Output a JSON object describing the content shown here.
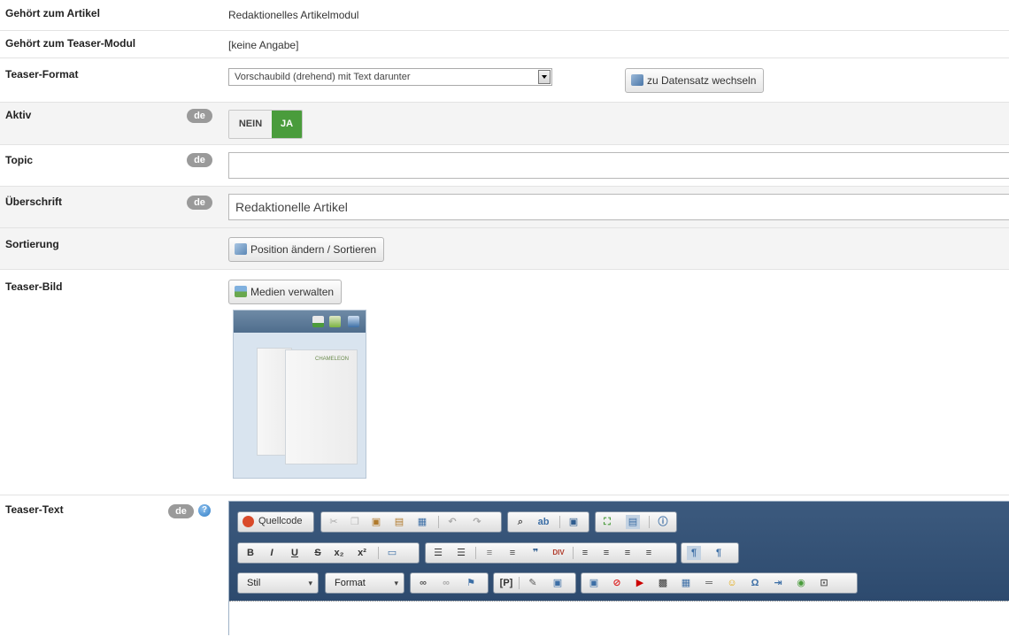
{
  "rows": {
    "article": {
      "label": "Gehört zum Artikel",
      "value": "Redaktionelles Artikelmodul"
    },
    "teaser_module": {
      "label": "Gehört zum Teaser-Modul",
      "value": "[keine Angabe]"
    },
    "teaser_format": {
      "label": "Teaser-Format",
      "selected": "Vorschaubild (drehend) mit Text darunter",
      "switch_button": "zu Datensatz wechseln"
    },
    "active": {
      "label": "Aktiv",
      "lang": "de",
      "off": "NEIN",
      "on": "JA"
    },
    "topic": {
      "label": "Topic",
      "lang": "de",
      "value": ""
    },
    "heading": {
      "label": "Überschrift",
      "lang": "de",
      "value": "Redaktionelle Artikel"
    },
    "sorting": {
      "label": "Sortierung",
      "button": "Position ändern / Sortieren"
    },
    "teaser_image": {
      "label": "Teaser-Bild",
      "button": "Medien verwalten",
      "image_text": "CHAMELEON"
    },
    "teaser_text": {
      "label": "Teaser-Text",
      "lang": "de",
      "help": "?"
    }
  },
  "editor": {
    "source_button": "Quellcode",
    "style_combo": "Stil",
    "format_combo": "Format",
    "paragraph_tag": "[P]"
  },
  "colors": {
    "active_on": "#4a9c3c",
    "badge": "#9a9a9a",
    "editor_toolbar": "#2d4a6e"
  }
}
